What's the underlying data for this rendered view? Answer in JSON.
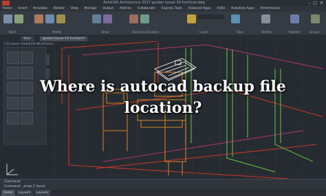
{
  "window": {
    "title": "AutoCAD Architecture 2017   garden house 10 furniture.dwg",
    "minimize": "–",
    "maximize": "□",
    "close": "✕"
  },
  "menu": [
    "Home",
    "Insert",
    "Annotate",
    "Render",
    "View",
    "Manage",
    "Output",
    "Add-ins",
    "Collaborate",
    "Express Tools",
    "Featured Apps",
    "A360",
    "Autodesk Apps",
    "Performance"
  ],
  "ribbon": {
    "groups": [
      "Build",
      "Modify",
      "Draw",
      "Section & Elevation",
      "Layers",
      "View",
      "Utilities",
      "Palettes",
      "Groups"
    ]
  },
  "tabs": [
    "Start",
    "garden house 10 furniture*"
  ],
  "viewport": {
    "label": "[-][Custom View][2D Wireframe]"
  },
  "headline": "Where is autocad backup file location?",
  "command": {
    "line1": "Command:",
    "line2": "Command: _erase 1 found"
  },
  "status_tabs": [
    "Model",
    "Layout1",
    "Layout2"
  ],
  "colors": {
    "wall_red": "#c0392b",
    "furniture_orange": "#d4872a",
    "wall_green": "#5fae3a",
    "selection_white": "#e8e8e8"
  }
}
